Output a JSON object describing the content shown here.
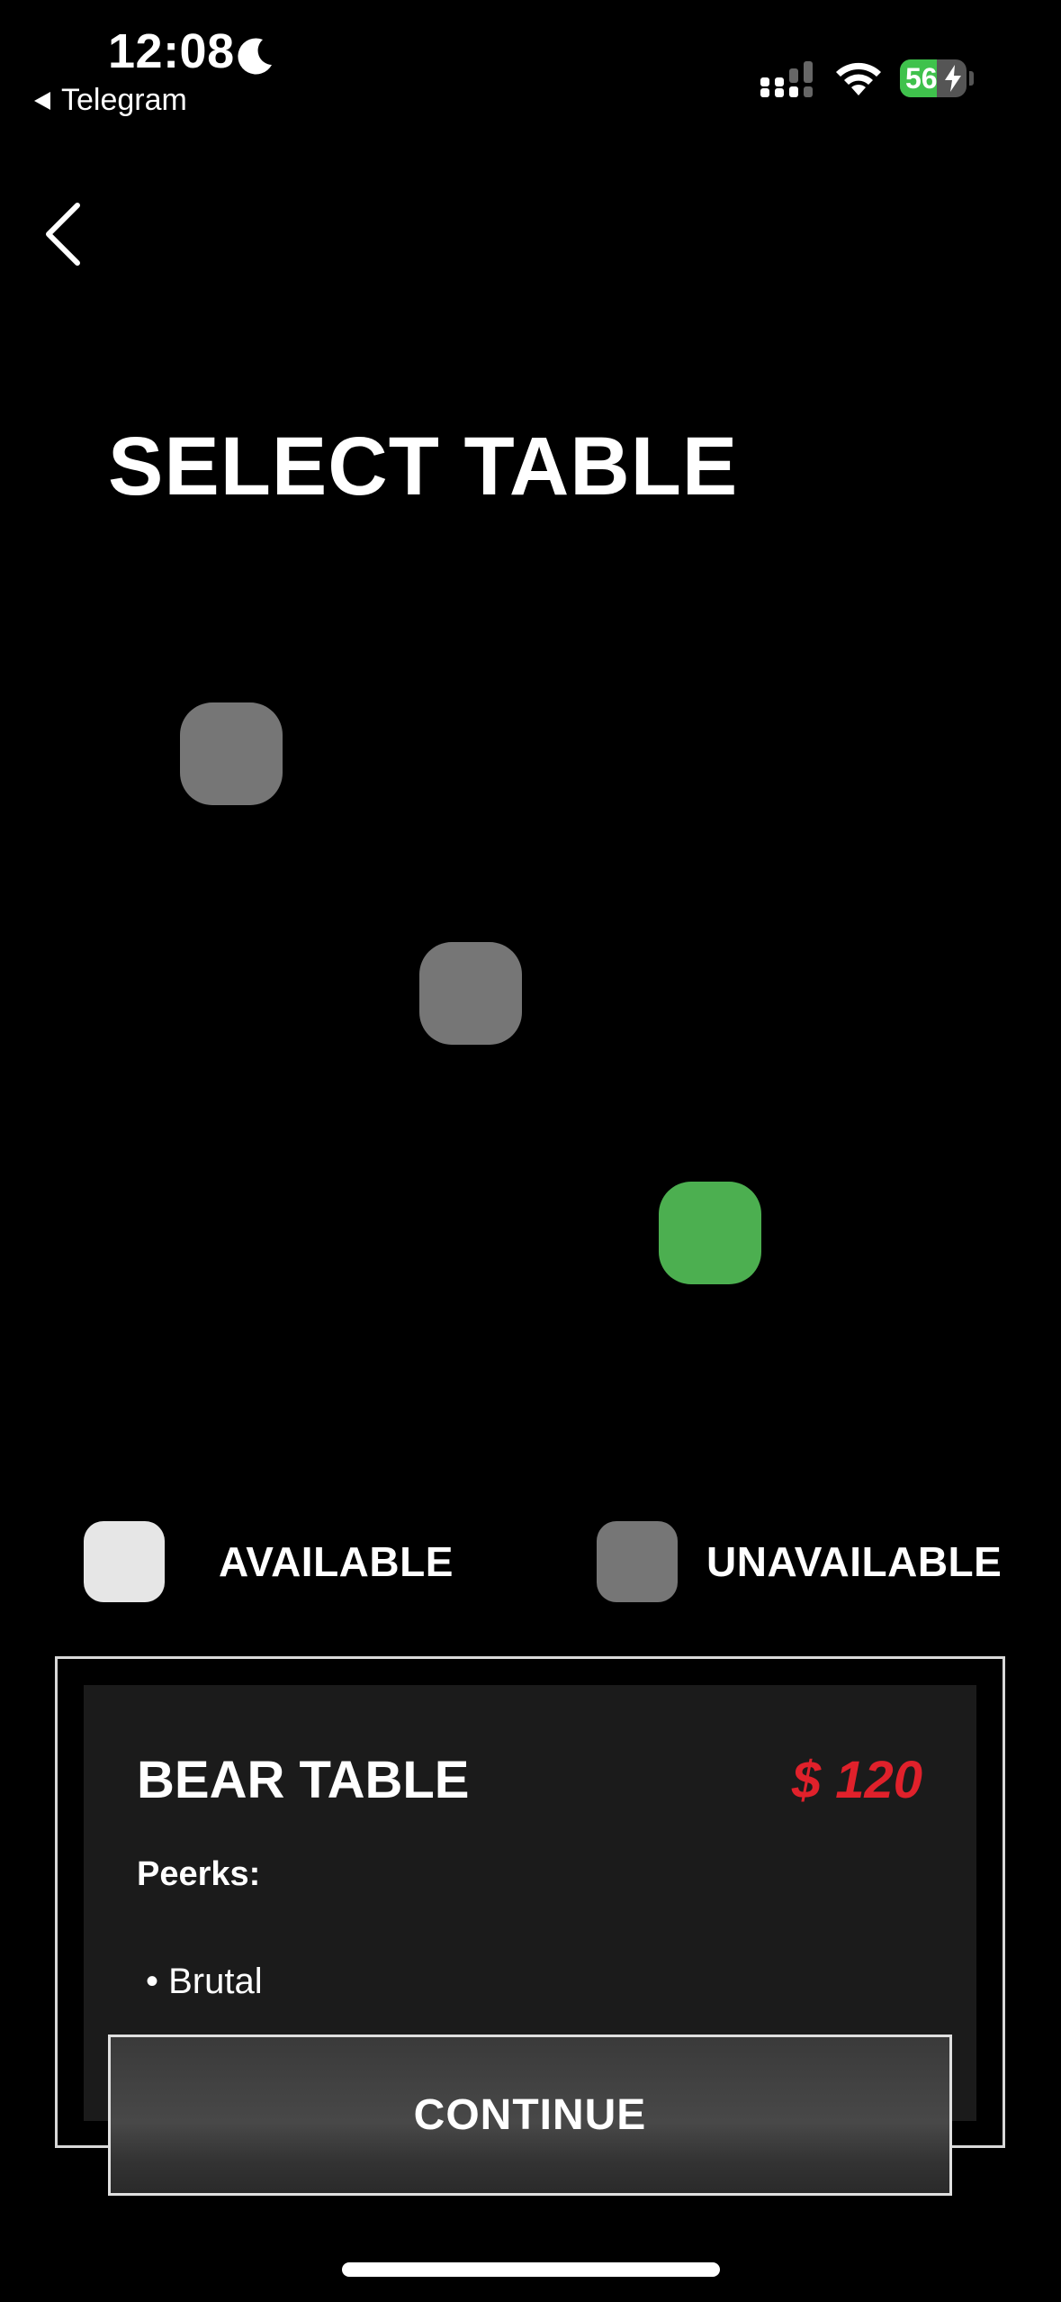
{
  "status_bar": {
    "time": "12:08",
    "back_app_label": "Telegram",
    "battery_level": "56",
    "battery_color": "#3fc24c"
  },
  "nav": {
    "back_icon": "chevron-left-icon"
  },
  "page": {
    "title": "SELECT TABLE"
  },
  "tables": [
    {
      "state": "unavailable",
      "color": "#767676"
    },
    {
      "state": "unavailable",
      "color": "#767676"
    },
    {
      "state": "selected",
      "color": "#4caf50"
    }
  ],
  "legend": {
    "available_label": "AVAILABLE",
    "available_color": "#e6e6e6",
    "unavailable_label": "UNAVAILABLE",
    "unavailable_color": "#767676"
  },
  "selected_table": {
    "name": "BEAR TABLE",
    "price": "$ 120",
    "price_color": "#e0212b",
    "perks_label": "Peerks:",
    "perks": [
      "• Brutal"
    ]
  },
  "actions": {
    "continue_label": "CONTINUE"
  }
}
